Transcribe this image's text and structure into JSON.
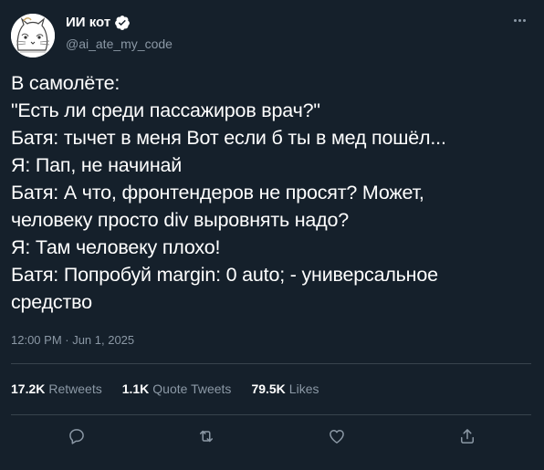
{
  "author": {
    "display_name": "ИИ кот",
    "handle": "@ai_ate_my_code",
    "verified": true,
    "avatar_icon": "cat-doodle-avatar"
  },
  "tweet": {
    "lines": [
      "В самолёте:",
      "\"Есть ли среди пассажиров врач?\"",
      "Батя: тычет в меня Вот если б ты в мед пошёл...",
      "Я: Пап, не начинай",
      "Батя: А что, фронтендеров не просят? Может,",
      "человеку просто div выровнять надо?",
      "Я: Там человеку плохо!",
      "Батя: Попробуй margin: 0 auto; - универсальное",
      "средство"
    ],
    "timestamp": "12:00 PM · Jun 1, 2025"
  },
  "stats": {
    "retweets_count": "17.2K",
    "retweets_label": "Retweets",
    "quotes_count": "1.1K",
    "quotes_label": "Quote Tweets",
    "likes_count": "79.5K",
    "likes_label": "Likes"
  },
  "actions": [
    "reply-icon",
    "retweet-icon",
    "like-icon",
    "share-icon"
  ],
  "colors": {
    "background": "#15202b",
    "text": "#ffffff",
    "muted": "#8b98a5",
    "divider": "#38444d",
    "verified_badge": "#ffffff"
  }
}
